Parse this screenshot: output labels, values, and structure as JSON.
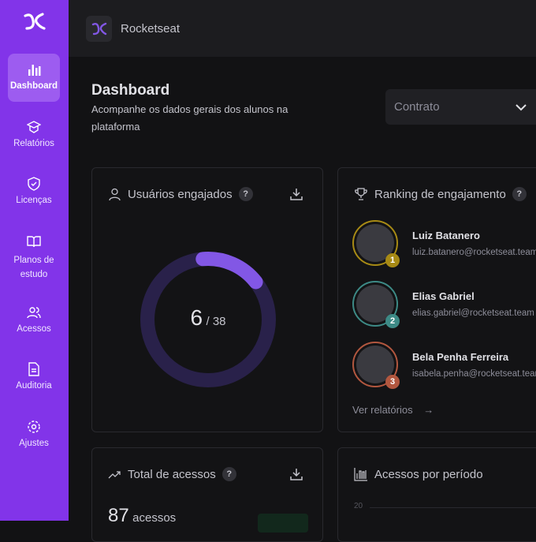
{
  "brand": "Rocketseat",
  "sidebar": {
    "items": [
      {
        "label": "Dashboard"
      },
      {
        "label": "Relatórios"
      },
      {
        "label": "Licenças"
      },
      {
        "label": "Planos de estudo"
      },
      {
        "label": "Acessos"
      },
      {
        "label": "Auditoria"
      },
      {
        "label": "Ajustes"
      }
    ]
  },
  "page": {
    "title": "Dashboard",
    "subtitle": "Acompanhe os dados gerais dos alunos na plataforma"
  },
  "filter": {
    "selected": "Contrato"
  },
  "engaged": {
    "title": "Usuários engajados",
    "help": "?",
    "value": 6,
    "total": 38,
    "value_label": "6",
    "total_label": "/ 38",
    "accent": "#8257e5",
    "track": "#29214a"
  },
  "ranking": {
    "title": "Ranking de engajamento",
    "help": "?",
    "link": "Ver relatórios",
    "items": [
      {
        "rank": "1",
        "name": "Luiz Batanero",
        "email": "luiz.batanero@rocketseat.team",
        "color": "#a78a15"
      },
      {
        "rank": "2",
        "name": "Elias Gabriel",
        "email": "elias.gabriel@rocketseat.team",
        "color": "#3d8a86"
      },
      {
        "rank": "3",
        "name": "Bela Penha Ferreira",
        "email": "isabela.penha@rocketseat.team",
        "color": "#b2573f"
      }
    ]
  },
  "access": {
    "title": "Total de acessos",
    "help": "?",
    "value": "87",
    "unit": "acessos"
  },
  "period": {
    "title": "Acessos por período",
    "y_tick": "20"
  }
}
